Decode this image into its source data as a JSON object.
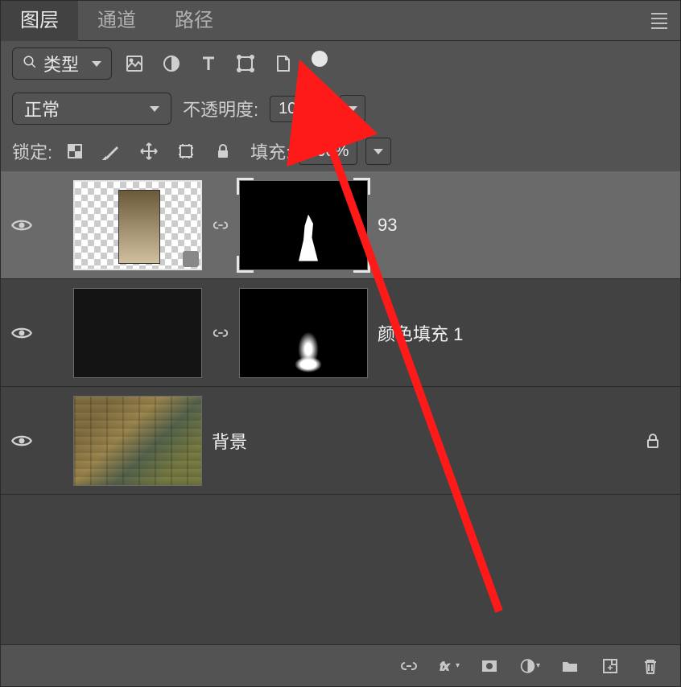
{
  "tabs": {
    "layers": "图层",
    "channels": "通道",
    "paths": "路径"
  },
  "filter": {
    "type_label": "类型"
  },
  "blend": {
    "mode": "正常",
    "opacity_label": "不透明度:",
    "opacity_value": "100%"
  },
  "lock": {
    "label": "锁定:",
    "fill_label": "填充:",
    "fill_value": "100%"
  },
  "layers": [
    {
      "name": "93",
      "visible": true,
      "has_mask": true,
      "selected": true
    },
    {
      "name": "颜色填充 1",
      "visible": true,
      "has_mask": true
    },
    {
      "name": "背景",
      "visible": true,
      "locked": true
    }
  ],
  "icons": {
    "image_filter": "image-filter-icon",
    "adjust_filter": "adjustment-filter-icon",
    "text_filter": "text-filter-icon",
    "shape_filter": "shape-filter-icon",
    "smart_filter": "smartobject-filter-icon"
  }
}
